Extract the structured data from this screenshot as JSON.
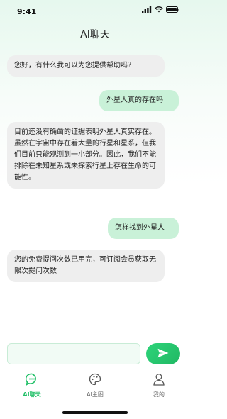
{
  "status": {
    "time": "9:41",
    "icons": [
      "cellular-signal-icon",
      "wifi-icon",
      "battery-icon"
    ]
  },
  "header": {
    "title": "AI聊天"
  },
  "messages": [
    {
      "role": "ai",
      "text": "您好，有什么我可以为您提供帮助吗？"
    },
    {
      "role": "user",
      "text": "外星人真的存在吗"
    },
    {
      "role": "ai",
      "text": "目前还没有确凿的证据表明外星人真实存在。虽然在宇宙中存在着大量的行星和星系，但我们目前只能观测到一小部分。因此，我们不能排除在未知星系或未探索行星上存在生命的可能性。"
    },
    {
      "role": "user",
      "text": "怎样找到外星人"
    },
    {
      "role": "ai",
      "text": "您的免费提问次数已用完，可订阅会员获取无限次提问次数"
    }
  ],
  "composer": {
    "input_value": "",
    "send_icon": "send-icon"
  },
  "tabs": [
    {
      "label": "AI聊天",
      "icon": "chat-bubble-icon",
      "active": true
    },
    {
      "label": "AI主图",
      "icon": "palette-icon",
      "active": false
    },
    {
      "label": "我的",
      "icon": "user-icon",
      "active": false
    }
  ],
  "colors": {
    "accent": "#1fbf66",
    "user_bubble": "#c9f1d8",
    "ai_bubble": "#eeeeee"
  }
}
